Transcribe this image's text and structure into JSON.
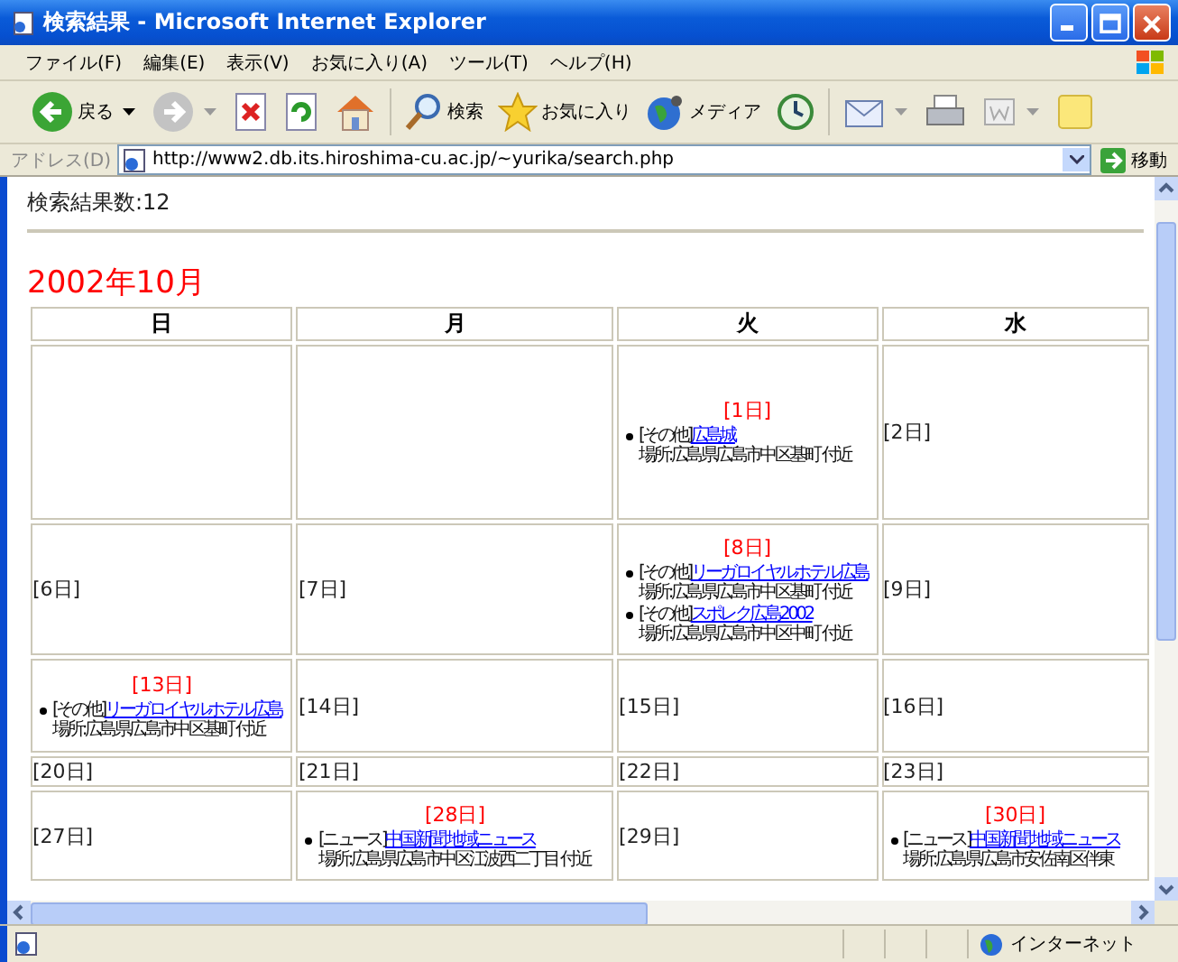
{
  "window": {
    "title": "検索結果 - Microsoft Internet Explorer"
  },
  "menu": [
    {
      "label": "ファイル(F)"
    },
    {
      "label": "編集(E)"
    },
    {
      "label": "表示(V)"
    },
    {
      "label": "お気に入り(A)"
    },
    {
      "label": "ツール(T)"
    },
    {
      "label": "ヘルプ(H)"
    }
  ],
  "toolbar": [
    {
      "kind": "back",
      "label": "戻る",
      "dropdown": true
    },
    {
      "kind": "forward",
      "dropdown": true
    },
    {
      "kind": "stop",
      "dropdown": false
    },
    {
      "kind": "refresh",
      "dropdown": false
    },
    {
      "kind": "home",
      "dropdown": false
    },
    {
      "kind": "separator"
    },
    {
      "kind": "search",
      "label": "検索",
      "dropdown": false
    },
    {
      "kind": "favorites",
      "label": "お気に入り",
      "dropdown": false
    },
    {
      "kind": "media",
      "label": "メディア",
      "dropdown": false
    },
    {
      "kind": "history",
      "dropdown": false
    },
    {
      "kind": "separator"
    },
    {
      "kind": "mail",
      "dropdown": true
    },
    {
      "kind": "print",
      "dropdown": false
    },
    {
      "kind": "edit",
      "dropdown": true
    },
    {
      "kind": "notes",
      "dropdown": false
    }
  ],
  "address": {
    "label": "アドレス(D)",
    "url": "http://www2.db.its.hiroshima-cu.ac.jp/~yurika/search.php",
    "go": "移動"
  },
  "page": {
    "result_count": "検索結果数:12",
    "month": "2002年10月"
  },
  "calendar": {
    "columns": [
      "日",
      "月",
      "火",
      "水"
    ],
    "weeks": [
      [
        {
          "kind": "blank"
        },
        {
          "kind": "blank"
        },
        {
          "day": "[1日]",
          "events": [
            {
              "category": "[その他]",
              "link": "広島城",
              "place": "場所:広島県広島市中区基町 付近"
            }
          ]
        },
        {
          "day": "[2日]"
        }
      ],
      [
        {
          "day": "[6日]"
        },
        {
          "day": "[7日]"
        },
        {
          "day": "[8日]",
          "events": [
            {
              "category": "[その他]",
              "link": "リーガロイヤルホテル広島",
              "place": "場所:広島県広島市中区基町 付近"
            },
            {
              "category": "[その他]",
              "link": "スポレク広島2002",
              "place": "場所:広島県広島市中区中町 付近"
            }
          ]
        },
        {
          "day": "[9日]"
        }
      ],
      [
        {
          "day": "[13日]",
          "events": [
            {
              "category": "[その他]",
              "link": "リーガロイヤルホテル広島",
              "place": "場所:広島県広島市中区基町 付近"
            }
          ]
        },
        {
          "day": "[14日]"
        },
        {
          "day": "[15日]"
        },
        {
          "day": "[16日]"
        }
      ],
      [
        {
          "day": "[20日]"
        },
        {
          "day": "[21日]"
        },
        {
          "day": "[22日]"
        },
        {
          "day": "[23日]"
        }
      ],
      [
        {
          "day": "[27日]"
        },
        {
          "day": "[28日]",
          "events": [
            {
              "category": "[ニュース]",
              "link": "中国新聞 地域ニュース",
              "place": "場所:広島県広島市中区江波西二丁目 付近"
            }
          ]
        },
        {
          "day": "[29日]"
        },
        {
          "day": "[30日]",
          "events": [
            {
              "category": "[ニュース]",
              "link": "中国新聞 地域ニュース",
              "place": "場所:広島県広島市安佐南区伴東"
            }
          ]
        }
      ]
    ]
  },
  "status_bar": {
    "zone": "インターネット"
  }
}
